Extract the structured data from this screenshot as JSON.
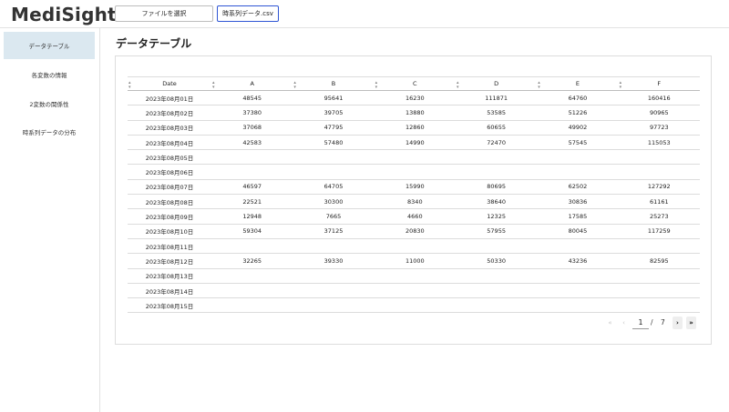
{
  "app": {
    "title": "MediSight"
  },
  "header": {
    "file_select_label": "ファイルを選択",
    "file_name": "時系列データ.csv"
  },
  "sidebar": {
    "items": [
      {
        "label": "データテーブル",
        "active": true
      },
      {
        "label": "各変数の情報",
        "active": false
      },
      {
        "label": "2変数の関係性",
        "active": false
      },
      {
        "label": "時系列データの分布",
        "active": false
      }
    ]
  },
  "main": {
    "title": "データテーブル",
    "table": {
      "columns": [
        "Date",
        "A",
        "B",
        "C",
        "D",
        "E",
        "F"
      ],
      "rows": [
        [
          "2023年08月01日",
          "48545",
          "95641",
          "16230",
          "111871",
          "64760",
          "160416"
        ],
        [
          "2023年08月02日",
          "37380",
          "39705",
          "13880",
          "53585",
          "51226",
          "90965"
        ],
        [
          "2023年08月03日",
          "37068",
          "47795",
          "12860",
          "60655",
          "49902",
          "97723"
        ],
        [
          "2023年08月04日",
          "42583",
          "57480",
          "14990",
          "72470",
          "57545",
          "115053"
        ],
        [
          "2023年08月05日",
          "",
          "",
          "",
          "",
          "",
          ""
        ],
        [
          "2023年08月06日",
          "",
          "",
          "",
          "",
          "",
          ""
        ],
        [
          "2023年08月07日",
          "46597",
          "64705",
          "15990",
          "80695",
          "62502",
          "127292"
        ],
        [
          "2023年08月08日",
          "22521",
          "30300",
          "8340",
          "38640",
          "30836",
          "61161"
        ],
        [
          "2023年08月09日",
          "12948",
          "7665",
          "4660",
          "12325",
          "17585",
          "25273"
        ],
        [
          "2023年08月10日",
          "59304",
          "37125",
          "20830",
          "57955",
          "80045",
          "117259"
        ],
        [
          "2023年08月11日",
          "",
          "",
          "",
          "",
          "",
          ""
        ],
        [
          "2023年08月12日",
          "32265",
          "39330",
          "11000",
          "50330",
          "43236",
          "82595"
        ],
        [
          "2023年08月13日",
          "",
          "",
          "",
          "",
          "",
          ""
        ],
        [
          "2023年08月14日",
          "",
          "",
          "",
          "",
          "",
          ""
        ],
        [
          "2023年08月15日",
          "",
          "",
          "",
          "",
          "",
          ""
        ]
      ]
    },
    "pagination": {
      "first_label": "«",
      "prev_label": "‹",
      "current_page": "1",
      "separator": "/",
      "total_pages": "7",
      "next_label": "›",
      "last_label": "»"
    }
  },
  "icons": {
    "sort": "sort-icon"
  },
  "colors": {
    "accent": "#2f55d4",
    "sidebar_active": "#dbe8f0"
  }
}
